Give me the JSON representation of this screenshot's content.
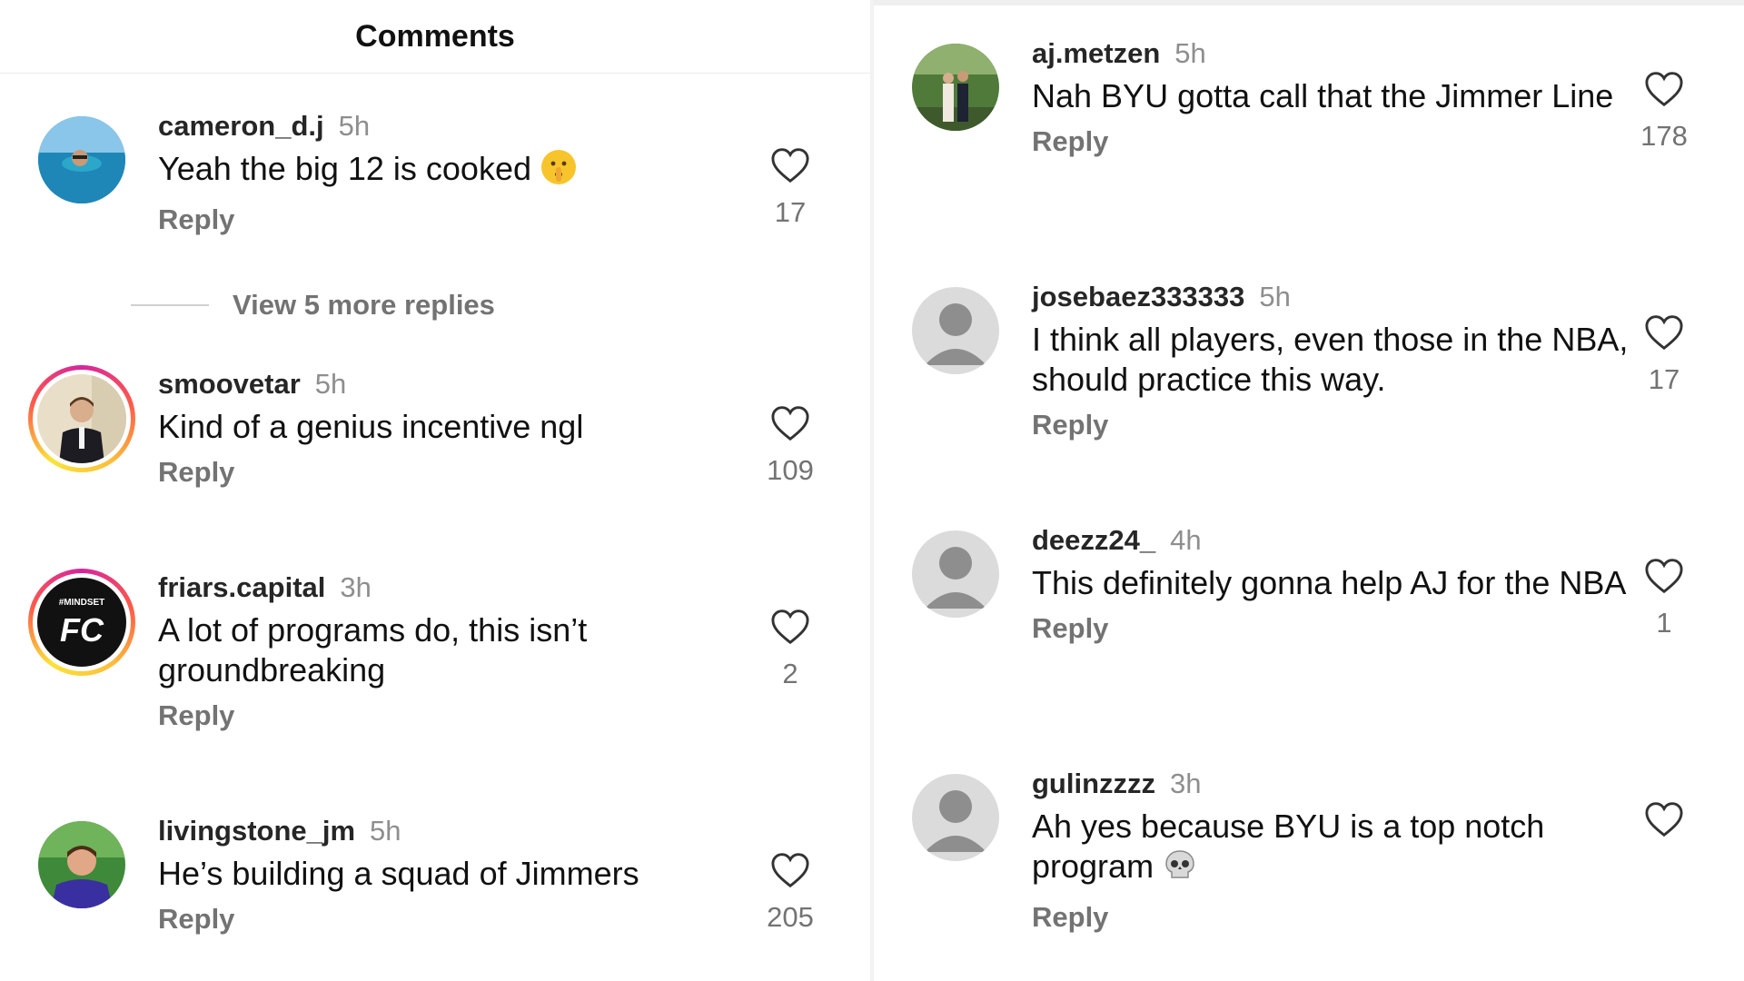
{
  "header": {
    "title": "Comments"
  },
  "left": {
    "comments": [
      {
        "username": "cameron_d.j",
        "time": "5h",
        "text": "Yeah the big 12 is cooked",
        "reply": "Reply",
        "likes": "17",
        "avatar": "beach-photo"
      },
      {
        "username": "smoovetar",
        "time": "5h",
        "text": "Kind of a genius incentive ngl",
        "reply": "Reply",
        "likes": "109",
        "avatar": "suit-photo"
      },
      {
        "username": "friars.capital",
        "time": "3h",
        "text": "A lot of programs do, this isn’t groundbreaking",
        "reply": "Reply",
        "likes": "2",
        "avatar": "mindset-fc-logo"
      },
      {
        "username": "livingstone_jm",
        "time": "5h",
        "text": "He’s building a squad of Jimmers",
        "reply": "Reply",
        "likes": "205",
        "avatar": "man-photo"
      }
    ],
    "view_more": "View 5 more replies",
    "logo_text": {
      "top": "#MINDSET",
      "main": "FC"
    }
  },
  "right": {
    "comments": [
      {
        "username": "aj.metzen",
        "time": "5h",
        "text": "Nah BYU gotta call that the Jimmer Line",
        "reply": "Reply",
        "likes": "178",
        "avatar": "couple-photo"
      },
      {
        "username": "josebaez333333",
        "time": "5h",
        "text": "I think all players, even those in the NBA, should practice this way.",
        "reply": "Reply",
        "likes": "17",
        "avatar": "default-avatar"
      },
      {
        "username": "deezz24_",
        "time": "4h",
        "text": "This definitely gonna help AJ for the NBA",
        "reply": "Reply",
        "likes": "1",
        "avatar": "default-avatar"
      },
      {
        "username": "gulinzzzz",
        "time": "3h",
        "text": "Ah yes because BYU is a top notch program",
        "reply": "Reply",
        "likes": "",
        "avatar": "default-avatar"
      }
    ]
  },
  "colors": {
    "username": "#262626",
    "secondary": "#737373",
    "time": "#8e8e8e",
    "default_avatar": "#dbdbdb"
  }
}
